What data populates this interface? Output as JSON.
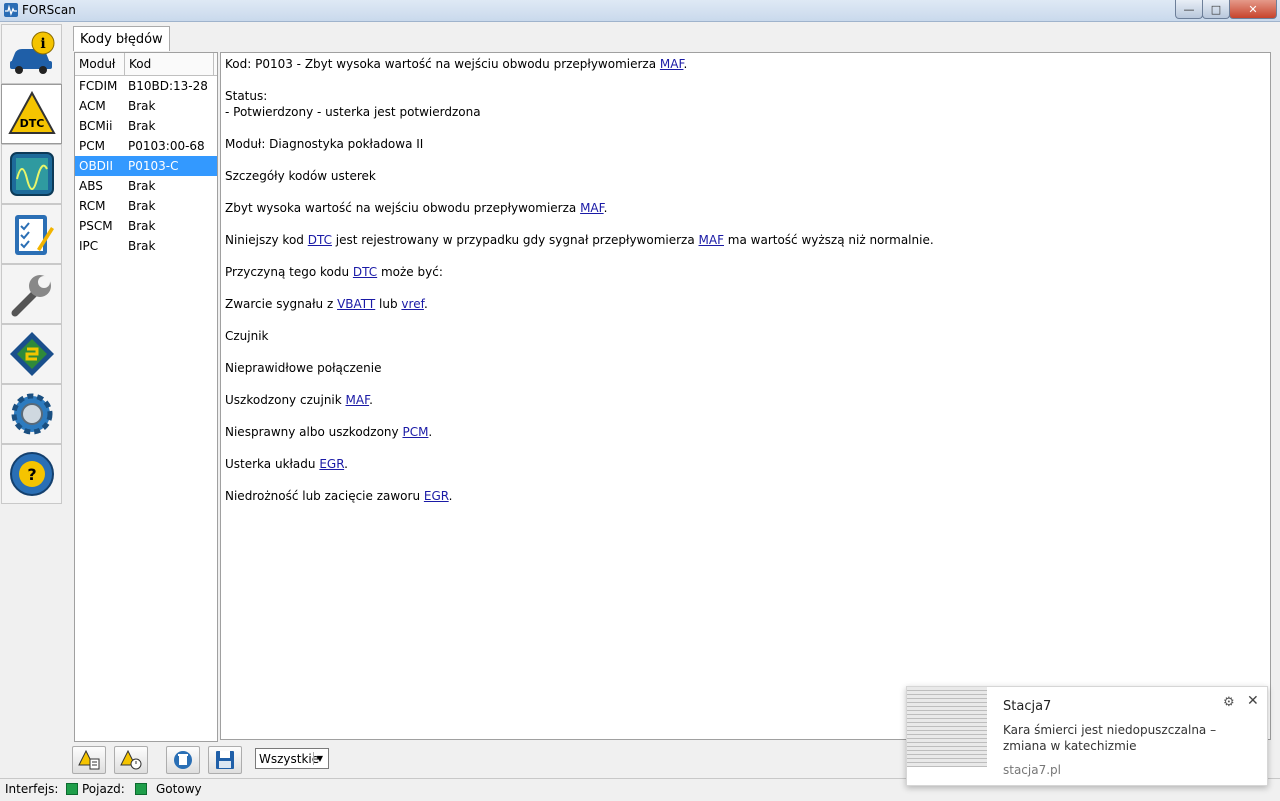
{
  "window": {
    "title": "FORScan"
  },
  "tab": {
    "label": "Kody błędów"
  },
  "table": {
    "headers": {
      "module": "Moduł",
      "code": "Kod"
    },
    "rows": [
      {
        "module": "FCDIM",
        "code": "B10BD:13-28"
      },
      {
        "module": "ACM",
        "code": "Brak"
      },
      {
        "module": "BCMii",
        "code": "Brak"
      },
      {
        "module": "PCM",
        "code": "P0103:00-68"
      },
      {
        "module": "OBDII",
        "code": "P0103-C"
      },
      {
        "module": "ABS",
        "code": "Brak"
      },
      {
        "module": "RCM",
        "code": "Brak"
      },
      {
        "module": "PSCM",
        "code": "Brak"
      },
      {
        "module": "IPC",
        "code": "Brak"
      }
    ],
    "selected_index": 4
  },
  "detail": {
    "line1": "Kod: P0103 - Zbyt wysoka wartość na wejściu obwodu przepływomierza ",
    "line1_link": "MAF",
    "status_label": "Status:",
    "status_value": " - Potwierdzony - usterka jest potwierdzona",
    "module_line": "Moduł: Diagnostyka pokładowa II",
    "details_heading": "Szczegóły kodów usterek",
    "desc": "Zbyt wysoka wartość na wejściu obwodu przepływomierza ",
    "desc_link": "MAF",
    "n1": "Niniejszy kod ",
    "n1_link1": "DTC",
    "n1_mid": " jest rejestrowany w przypadku gdy sygnał przepływomierza ",
    "n1_link2": "MAF",
    "n1_end": " ma wartość wyższą niż normalnie.",
    "cause_a": "Przyczyną tego kodu ",
    "cause_link": "DTC",
    "cause_b": " może być:",
    "short_a": "Zwarcie sygnału z ",
    "short_link1": "VBATT",
    "short_mid": " lub ",
    "short_link2": "vref",
    "sensor": "Czujnik",
    "bad_conn": "Nieprawidłowe połączenie",
    "damaged_a": "Uszkodzony czujnik ",
    "damaged_link": "MAF",
    "pcm_a": "Niesprawny albo uszkodzony ",
    "pcm_link": "PCM",
    "egr_a": "Usterka układu ",
    "egr_link": "EGR",
    "valve_a": "Niedrożność lub zacięcie zaworu ",
    "valve_link": "EGR",
    "dot": "."
  },
  "filter": {
    "selected": "Wszystkie"
  },
  "statusbar": {
    "interface": "Interfejs:",
    "vehicle": "Pojazd:",
    "ready": "Gotowy"
  },
  "notification": {
    "title": "Stacja7",
    "body": "Kara śmierci jest niedopuszczalna – zmiana w katechizmie",
    "source": "stacja7.pl"
  },
  "colors": {
    "selection": "#3399ff",
    "link": "#1a1aa6",
    "led": "#1f9e4a"
  }
}
